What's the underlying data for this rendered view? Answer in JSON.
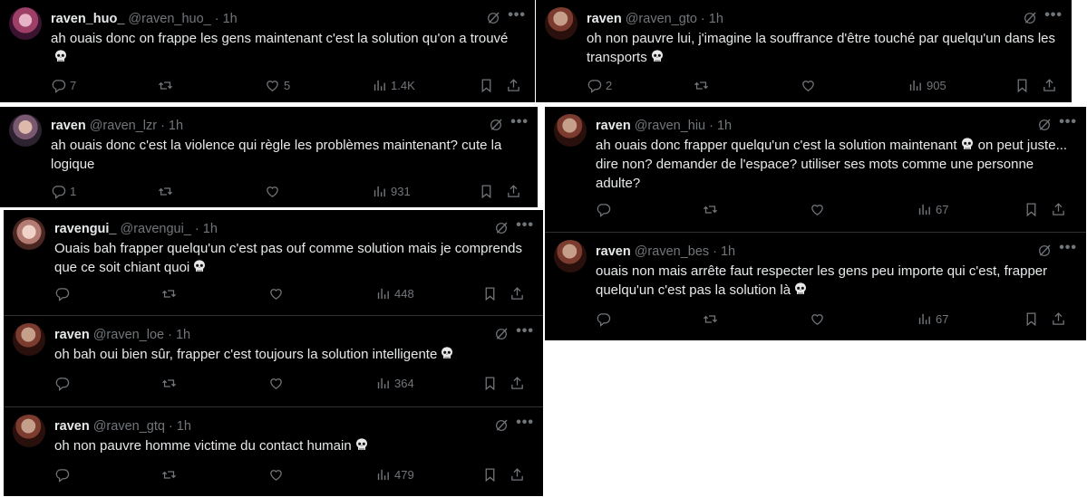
{
  "meta_sep": "·",
  "more_label": "•••",
  "tweets": [
    {
      "name": "raven_huo_",
      "handle": "@raven_huo_",
      "time": "1h",
      "text": "ah ouais donc on frappe les gens maintenant c'est la solution qu'on a trouvé",
      "emoji": "skull-icon",
      "replies": "7",
      "likes": "5",
      "views": "1.4K"
    },
    {
      "name": "raven",
      "handle": "@raven_gto",
      "time": "1h",
      "text": "oh non pauvre lui, j'imagine la souffrance d'être touché par quelqu'un dans les transports",
      "emoji": "skull-icon",
      "replies": "2",
      "likes": "",
      "views": "905"
    },
    {
      "name": "raven",
      "handle": "@raven_lzr",
      "time": "1h",
      "text": "ah ouais donc c'est la violence qui règle les problèmes maintenant? cute la logique",
      "emoji": "",
      "replies": "1",
      "likes": "",
      "views": "931"
    },
    {
      "name": "raven",
      "handle": "@raven_hiu",
      "time": "1h",
      "text_before": "ah ouais donc frapper quelqu'un c'est la solution maintenant",
      "text_after": "on peut juste... dire non? demander de l'espace? utiliser ses mots comme une personne adulte?",
      "emoji": "skull-icon",
      "replies": "",
      "likes": "",
      "views": "67"
    },
    {
      "name": "ravengui_",
      "handle": "@ravengui_",
      "time": "1h",
      "text": "Ouais bah frapper quelqu'un c'est pas ouf comme solution mais je comprends que ce soit chiant quoi",
      "emoji": "skull-icon",
      "replies": "",
      "likes": "",
      "views": "448"
    },
    {
      "name": "raven",
      "handle": "@raven_bes",
      "time": "1h",
      "text": "ouais non mais arrête faut respecter les gens peu importe qui c'est, frapper quelqu'un c'est pas la solution là",
      "emoji": "skull-icon",
      "replies": "",
      "likes": "",
      "views": "67"
    },
    {
      "name": "raven",
      "handle": "@raven_loe",
      "time": "1h",
      "text": "oh bah oui bien sûr, frapper c'est toujours la solution intelligente",
      "emoji": "skull-icon",
      "replies": "",
      "likes": "",
      "views": "364"
    },
    {
      "name": "raven",
      "handle": "@raven_gtq",
      "time": "1h",
      "text": "oh non pauvre homme victime du contact humain",
      "emoji": "skull-icon",
      "replies": "",
      "likes": "",
      "views": "479"
    }
  ]
}
